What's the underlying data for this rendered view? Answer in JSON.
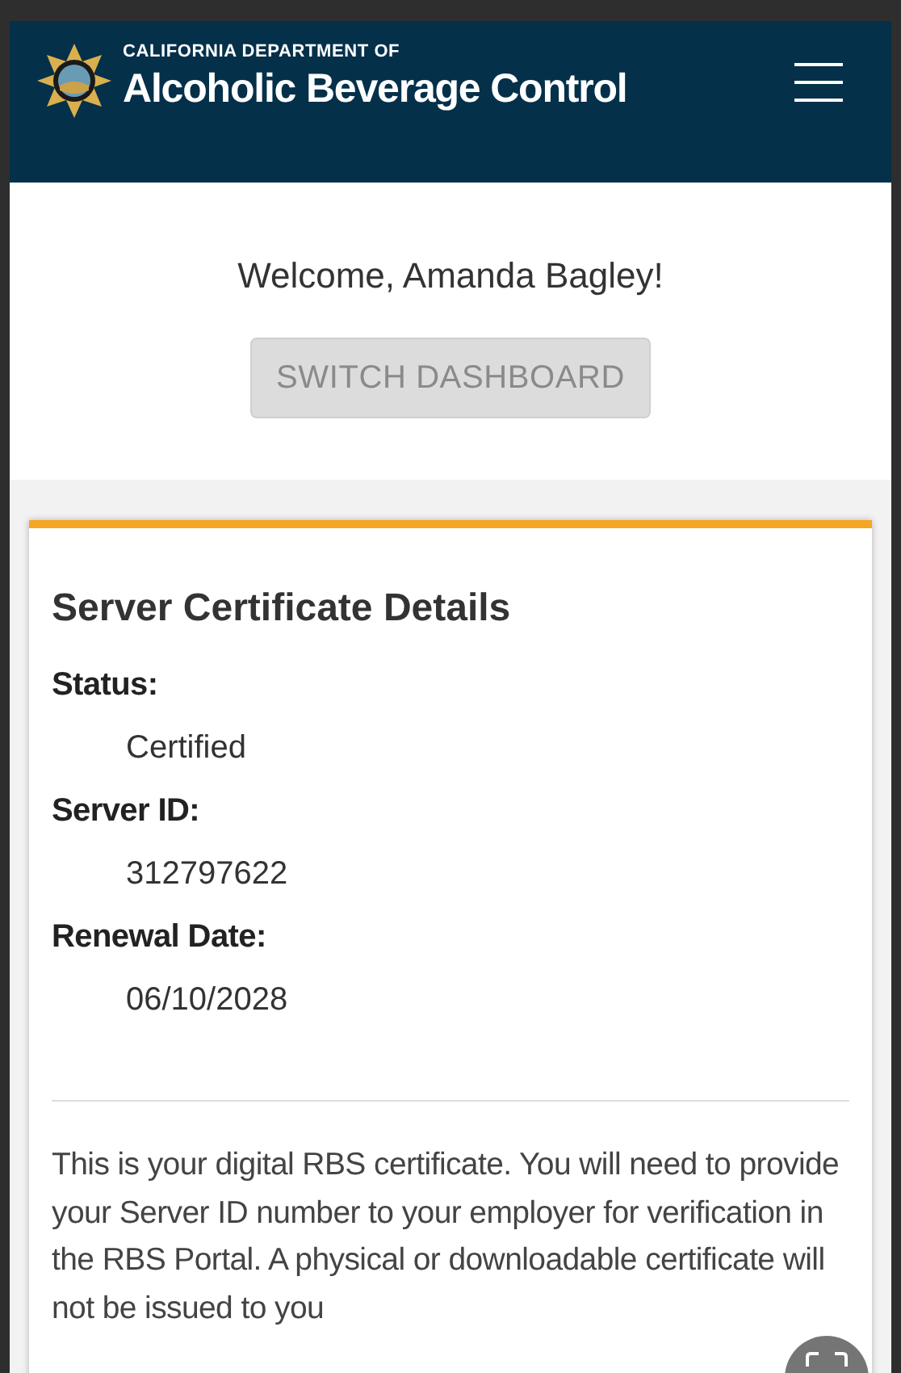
{
  "header": {
    "agency_line": "CALIFORNIA DEPARTMENT OF",
    "title": "Alcoholic Beverage Control"
  },
  "welcome": "Welcome, Amanda Bagley!",
  "switch_button": {
    "label": "SWITCH DASHBOARD",
    "disabled": true
  },
  "card": {
    "title": "Server Certificate Details",
    "fields": [
      {
        "label": "Status:",
        "value": "Certified"
      },
      {
        "label": "Server ID:",
        "value": "312797622"
      },
      {
        "label": "Renewal Date:",
        "value": "06/10/2028"
      }
    ],
    "note": "This is your digital RBS certificate. You will need to provide your Server ID number to your employer for verification in the RBS Portal. A physical or downloadable certificate will not be issued to you"
  }
}
